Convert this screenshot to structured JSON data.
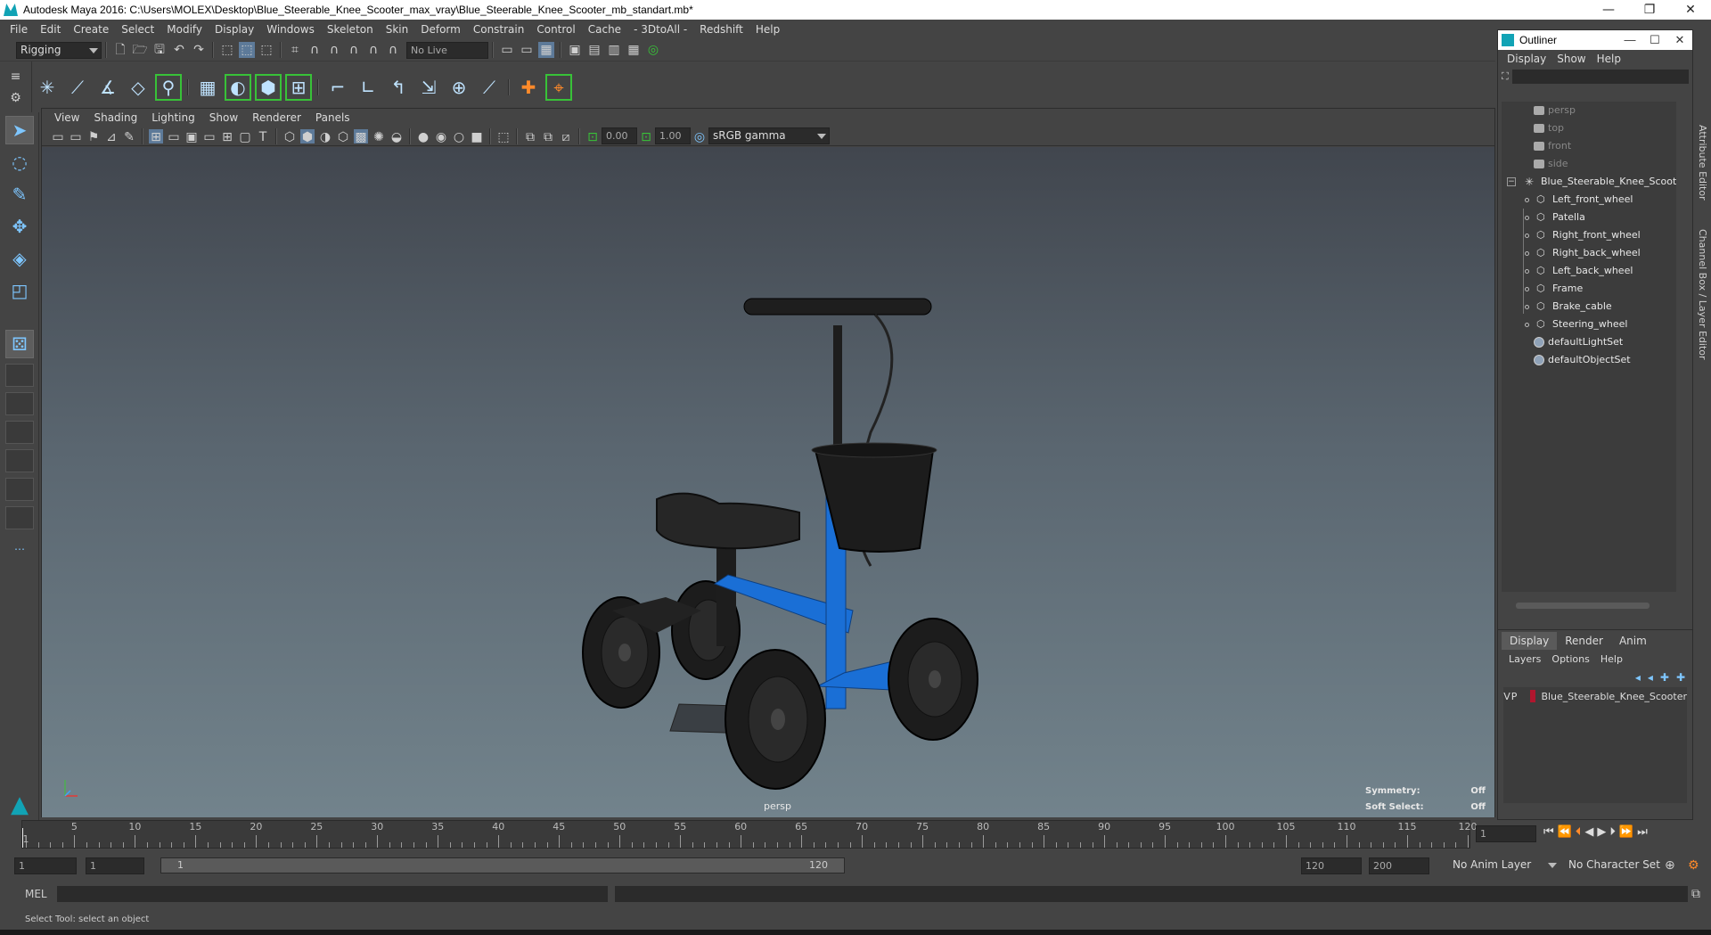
{
  "window": {
    "title": "Autodesk Maya 2016: C:\\Users\\MOLEX\\Desktop\\Blue_Steerable_Knee_Scooter_max_vray\\Blue_Steerable_Knee_Scooter_mb_standart.mb*"
  },
  "menubar": [
    "File",
    "Edit",
    "Create",
    "Select",
    "Modify",
    "Display",
    "Windows",
    "Skeleton",
    "Skin",
    "Deform",
    "Constrain",
    "Control",
    "Cache",
    "- 3DtoAll -",
    "Redshift",
    "Help"
  ],
  "statusline": {
    "menuset": "Rigging",
    "live_surface": "No Live Surface"
  },
  "panel": {
    "menu": [
      "View",
      "Shading",
      "Lighting",
      "Show",
      "Renderer",
      "Panels"
    ],
    "exposure": "0.00",
    "gamma": "1.00",
    "colorspace": "sRGB gamma",
    "camera_label": "persp",
    "hud": {
      "symmetry_label": "Symmetry:",
      "symmetry_value": "Off",
      "softselect_label": "Soft Select:",
      "softselect_value": "Off"
    }
  },
  "outliner": {
    "title": "Outliner",
    "menu": [
      "Display",
      "Show",
      "Help"
    ],
    "cameras": [
      "persp",
      "top",
      "front",
      "side"
    ],
    "group": "Blue_Steerable_Knee_Scooter",
    "children": [
      "Left_front_wheel",
      "Patella",
      "Right_front_wheel",
      "Right_back_wheel",
      "Left_back_wheel",
      "Frame",
      "Brake_cable",
      "Steering_wheel"
    ],
    "sets": [
      "defaultLightSet",
      "defaultObjectSet"
    ]
  },
  "side_tabs": {
    "attribute": "Attribute Editor",
    "channel": "Channel Box / Layer Editor"
  },
  "layers": {
    "tabs": [
      "Display",
      "Render",
      "Anim"
    ],
    "menu": [
      "Layers",
      "Options",
      "Help"
    ],
    "row": {
      "v": "V",
      "p": "P",
      "name": "Blue_Steerable_Knee_Scooter",
      "color": "#b0162e"
    }
  },
  "timeslider": {
    "ticks": [
      "5",
      "10",
      "15",
      "20",
      "25",
      "30",
      "35",
      "40",
      "45",
      "50",
      "55",
      "60",
      "65",
      "70",
      "75",
      "80",
      "85",
      "90",
      "95",
      "100",
      "105",
      "110",
      "115",
      "120"
    ],
    "first": "1",
    "current_frame": "1"
  },
  "range": {
    "start": "1",
    "inner_start": "1",
    "bar_start": "1",
    "bar_end": "120",
    "end": "120",
    "total": "200",
    "anim_layer": "No Anim Layer",
    "char_set": "No Character Set"
  },
  "cmd": {
    "label": "MEL"
  },
  "help": {
    "text": "Select Tool: select an object"
  },
  "colors": {
    "accent": "#11a3b5",
    "frame_blue": "#1a6fd6",
    "bg": "#444444"
  }
}
